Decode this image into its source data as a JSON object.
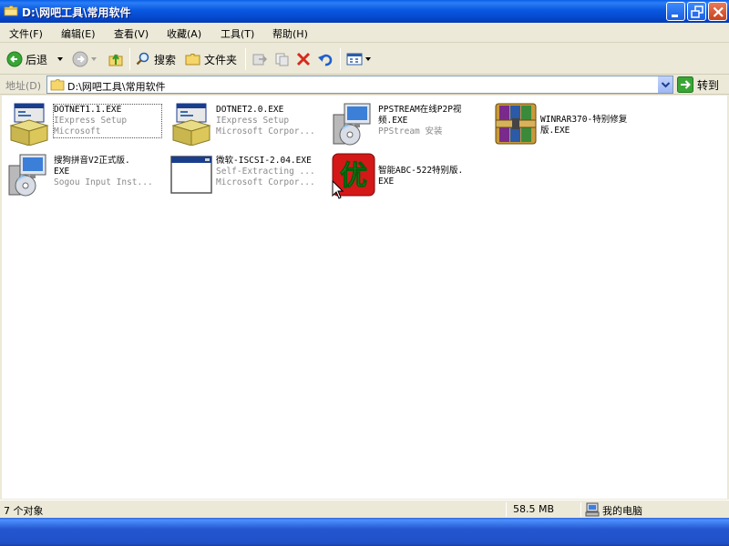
{
  "window": {
    "title": "D:\\网吧工具\\常用软件"
  },
  "menu": [
    {
      "label": "文件(F)"
    },
    {
      "label": "编辑(E)"
    },
    {
      "label": "查看(V)"
    },
    {
      "label": "收藏(A)"
    },
    {
      "label": "工具(T)"
    },
    {
      "label": "帮助(H)"
    }
  ],
  "toolbar": {
    "back_label": "后退",
    "search_label": "搜索",
    "folders_label": "文件夹"
  },
  "address": {
    "label": "地址(D)",
    "value": "D:\\网吧工具\\常用软件",
    "go_label": "转到"
  },
  "files": [
    {
      "name": "DOTNET1.1.EXE",
      "name2": "",
      "desc1": "IExpress Setup",
      "desc2": "Microsoft",
      "icon": "installer-box-icon"
    },
    {
      "name": "DOTNET2.0.EXE",
      "name2": "",
      "desc1": "IExpress Setup",
      "desc2": "Microsoft Corpor...",
      "icon": "installer-box-icon"
    },
    {
      "name": "PPSTREAM在线P2P视",
      "name2": "频.EXE",
      "desc1": "PPStream 安装",
      "desc2": "",
      "icon": "setup-cd-icon"
    },
    {
      "name": "WINRAR370-特别修复",
      "name2": "版.EXE",
      "desc1": "",
      "desc2": "",
      "icon": "winrar-icon"
    },
    {
      "name": "搜狗拼音V2正式版.",
      "name2": "EXE",
      "desc1": "Sogou Input Inst...",
      "desc2": "",
      "icon": "setup-cd-icon"
    },
    {
      "name": "微软-ISCSI-2.04.EXE",
      "name2": "",
      "desc1": "Self-Extracting ...",
      "desc2": "Microsoft Corpor...",
      "icon": "application-window-icon"
    },
    {
      "name": "智能ABC-522特别版.",
      "name2": "EXE",
      "desc1": "",
      "desc2": "",
      "icon": "abc-you-icon"
    }
  ],
  "abc_icon_char": "优",
  "status": {
    "count": "7 个对象",
    "size": "58.5 MB",
    "location": "我的电脑"
  },
  "colors": {
    "titlebar": "#0a58e0",
    "window_bg": "#ece9d8",
    "desktop": "#3a6ea5"
  }
}
